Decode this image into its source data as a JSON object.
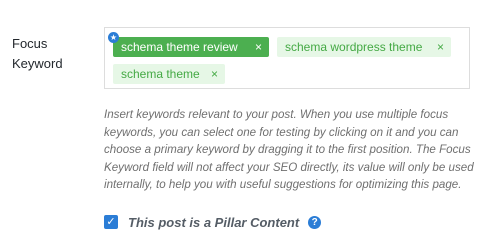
{
  "focus_keyword": {
    "label": "Focus\nKeyword",
    "tags": [
      {
        "text": "schema theme review",
        "primary": true,
        "remove_label": "×"
      },
      {
        "text": "schema wordpress theme",
        "primary": false,
        "remove_label": "×"
      },
      {
        "text": "schema theme",
        "primary": false,
        "remove_label": "×"
      }
    ],
    "primary_badge_icon": "★",
    "help_text": "Insert keywords relevant to your post. When you use multiple focus keywords, you can select one for testing by clicking on it and you can choose a primary keyword by dragging it to the first position. The Focus Keyword field will not affect your SEO directly, its value will only be used internally, to help you with useful suggestions for optimizing this page."
  },
  "pillar": {
    "checked": true,
    "check_icon": "✓",
    "label": "This post is a Pillar Content",
    "help_icon": "?"
  },
  "colors": {
    "primary_tag": "#4caf50",
    "secondary_tag_bg": "#e6f7e6",
    "secondary_tag_text": "#44a944",
    "accent_blue": "#2b7dd6"
  }
}
